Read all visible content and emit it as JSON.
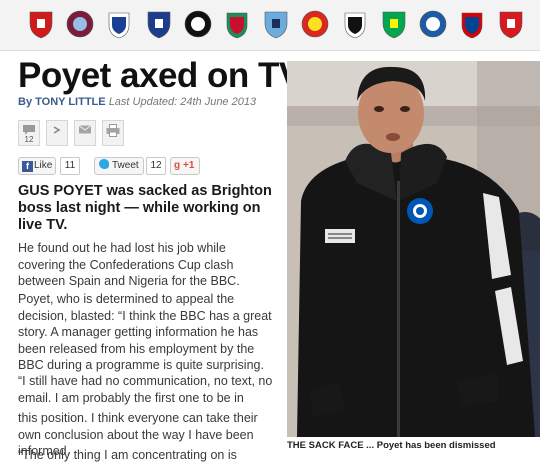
{
  "crests": {
    "items": [
      {
        "name": "arsenal-crest",
        "color": "#d11a1a",
        "accent": "#ffffff"
      },
      {
        "name": "aston-villa-crest",
        "color": "#7a1c3a",
        "accent": "#95bfe5"
      },
      {
        "name": "chelsea-crest",
        "color": "#1b3f94",
        "accent": "#ffffff"
      },
      {
        "name": "everton-crest",
        "color": "#1d3c8c",
        "accent": "#ffffff"
      },
      {
        "name": "fulham-crest",
        "color": "#111111",
        "accent": "#ffffff"
      },
      {
        "name": "liverpool-crest",
        "color": "#c8102e",
        "accent": "#1c8e5a"
      },
      {
        "name": "man-city-crest",
        "color": "#6cabdd",
        "accent": "#1c2c5b"
      },
      {
        "name": "man-united-crest",
        "color": "#da291c",
        "accent": "#fbe122"
      },
      {
        "name": "newcastle-crest",
        "color": "#111111",
        "accent": "#ffffff"
      },
      {
        "name": "norwich-crest",
        "color": "#00a650",
        "accent": "#fff200"
      },
      {
        "name": "qpr-crest",
        "color": "#1d5ba4",
        "accent": "#ffffff"
      },
      {
        "name": "reading-crest",
        "color": "#004494",
        "accent": "#dd0000"
      },
      {
        "name": "southampton-crest",
        "color": "#d71920",
        "accent": "#ffffff"
      }
    ]
  },
  "article": {
    "headline": "Poyet axed on TV",
    "byline_by": "By",
    "author": "TONY LITTLE",
    "last_updated": "Last Updated: 24th June 2013",
    "intro": "GUS POYET was sacked as Brighton boss last night — while working on live TV.",
    "paragraphs": [
      "He found out he had lost his job while covering the Confederations Cup clash between Spain and Nigeria for the BBC.",
      "Poyet, who is determined to appeal the decision, blasted: “I think the BBC has a great story. A manager getting information he has been released from his employment by the BBC during a programme is quite surprising.",
      "“I still have had no communication, no text, no email. I am probably the first one to be in",
      "this position. I think everyone can take their own conclusion about the way I have been informed.",
      "“The only thing I am concentrating on is"
    ]
  },
  "tools": {
    "comment_count": "12"
  },
  "social": {
    "like_label": "Like",
    "like_count": "11",
    "tweet_label": "Tweet",
    "tweet_count": "12",
    "gplus_label": "+1"
  },
  "photo": {
    "caption": "THE SACK FACE ... Poyet has been dismissed"
  },
  "colors": {
    "byline_blue": "#3b5b8f",
    "brighton_blue": "#0057b8",
    "jacket": "#151515"
  }
}
